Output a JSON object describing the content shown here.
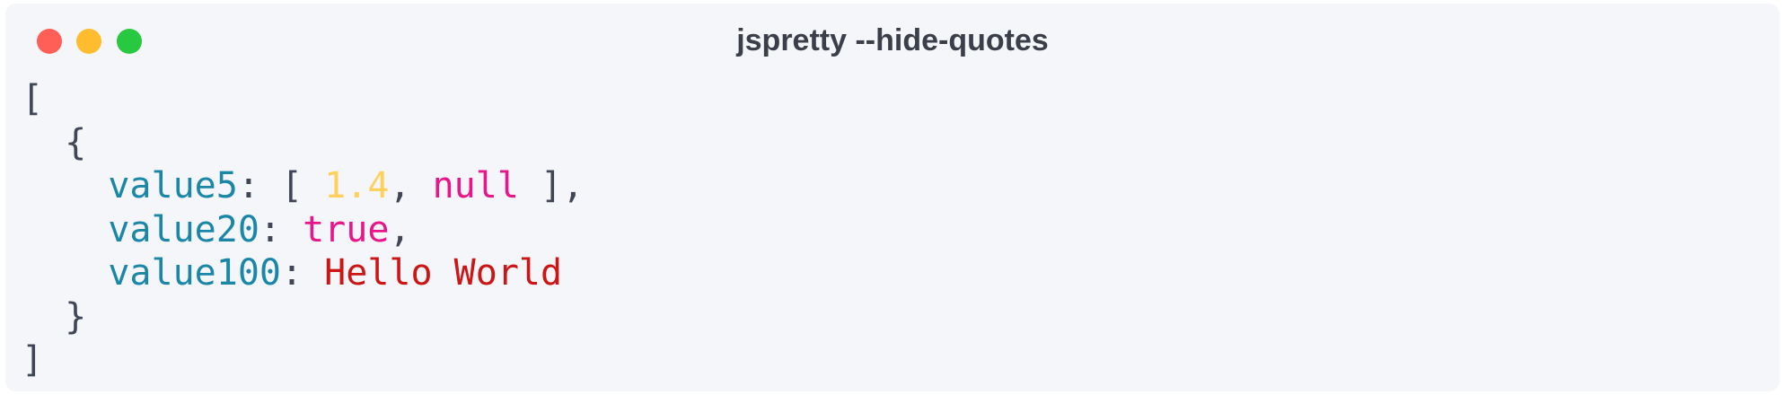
{
  "window": {
    "title": "jspretty --hide-quotes",
    "controls": {
      "close_color": "#ff5f57",
      "minimize_color": "#febc2e",
      "maximize_color": "#28c840"
    }
  },
  "code": {
    "open_array": "[",
    "open_object": "{",
    "entries": [
      {
        "key": "value5",
        "array_open": "[ ",
        "number": "1.4",
        "null": "null",
        "array_close": " ],"
      },
      {
        "key": "value20",
        "bool": "true"
      },
      {
        "key": "value100",
        "string": "Hello World"
      }
    ],
    "close_object": "}",
    "close_array": "]"
  },
  "colors": {
    "key": "#1a87a8",
    "number": "#ffd15c",
    "keyword": "#e8168a",
    "string": "#cc1515",
    "punctuation": "#3f4656",
    "background": "#f5f6f9"
  }
}
